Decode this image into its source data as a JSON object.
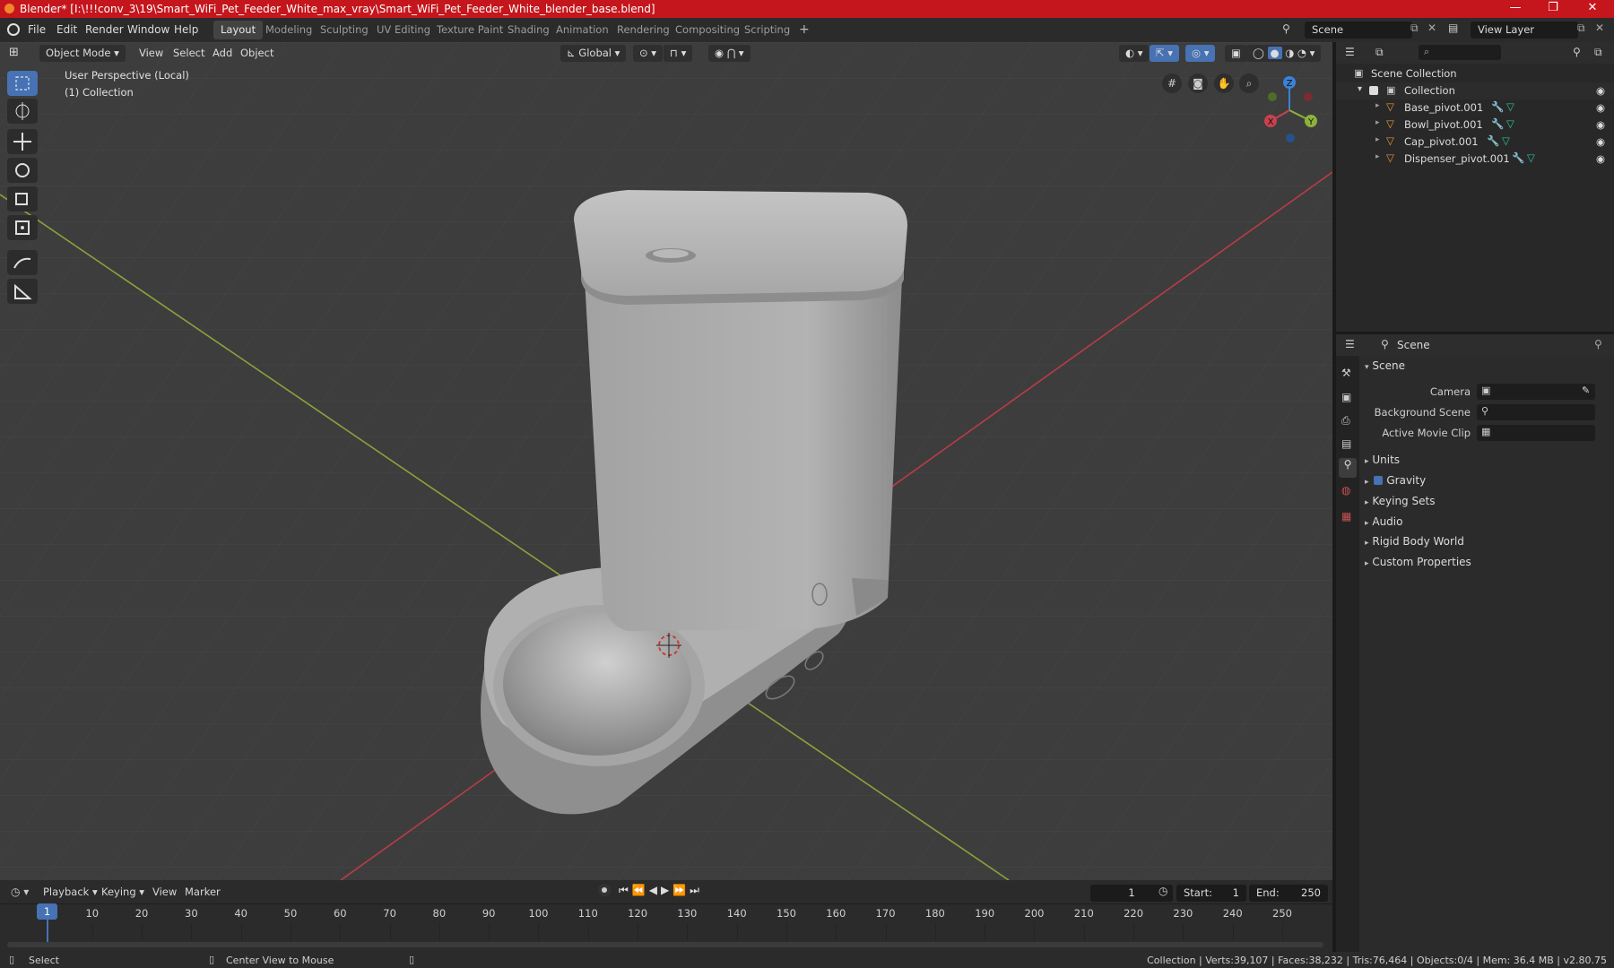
{
  "titlebar": {
    "title": "Blender* [I:\\!!!conv_3\\19\\Smart_WiFi_Pet_Feeder_White_max_vray\\Smart_WiFi_Pet_Feeder_White_blender_base.blend]",
    "minimize": "—",
    "maximize": "❐",
    "close": "✕"
  },
  "menu": {
    "file": "File",
    "edit": "Edit",
    "render": "Render",
    "window": "Window",
    "help": "Help"
  },
  "workspaces": [
    "Layout",
    "Modeling",
    "Sculpting",
    "UV Editing",
    "Texture Paint",
    "Shading",
    "Animation",
    "Rendering",
    "Compositing",
    "Scripting"
  ],
  "add_workspace": "+",
  "scene_field": "Scene",
  "view_layer_field": "View Layer",
  "viewport": {
    "mode": "Object Mode",
    "menus": {
      "view": "View",
      "select": "Select",
      "add": "Add",
      "object": "Object"
    },
    "orientation": "Global",
    "info_line1": "User Perspective (Local)",
    "info_line2": "(1) Collection",
    "gizmo": {
      "z": "Z",
      "y": "Y",
      "x": "X"
    }
  },
  "outliner": {
    "root": "Scene Collection",
    "collection": "Collection",
    "items": [
      "Base_pivot.001",
      "Bowl_pivot.001",
      "Cap_pivot.001",
      "Dispenser_pivot.001"
    ]
  },
  "properties": {
    "header": "Scene",
    "section": "Scene",
    "camera_label": "Camera",
    "background_scene_label": "Background Scene",
    "active_movie_clip_label": "Active Movie Clip",
    "panels": [
      "Units",
      "Gravity",
      "Keying Sets",
      "Audio",
      "Rigid Body World",
      "Custom Properties"
    ]
  },
  "timeline": {
    "menus": {
      "playback": "Playback",
      "keying": "Keying",
      "view": "View",
      "marker": "Marker"
    },
    "current_frame": "1",
    "start_label": "Start:",
    "start_value": "1",
    "end_label": "End:",
    "end_value": "250",
    "ticks": [
      "1",
      "10",
      "20",
      "30",
      "40",
      "50",
      "60",
      "70",
      "80",
      "90",
      "100",
      "110",
      "120",
      "130",
      "140",
      "150",
      "160",
      "170",
      "180",
      "190",
      "200",
      "210",
      "220",
      "230",
      "240",
      "250"
    ]
  },
  "status": {
    "select": "Select",
    "center_view": "Center View to Mouse",
    "stats": "Collection | Verts:39,107 | Faces:38,232 | Tris:76,464 | Objects:0/4 | Mem: 36.4 MB | v2.80.75"
  },
  "colors": {
    "accent": "#4772b3",
    "titlebar": "#c4161c",
    "x_axis": "#c8424e",
    "y_axis": "#8bb33a",
    "z_axis": "#3b82d6",
    "object_orange": "#e39a3b"
  }
}
